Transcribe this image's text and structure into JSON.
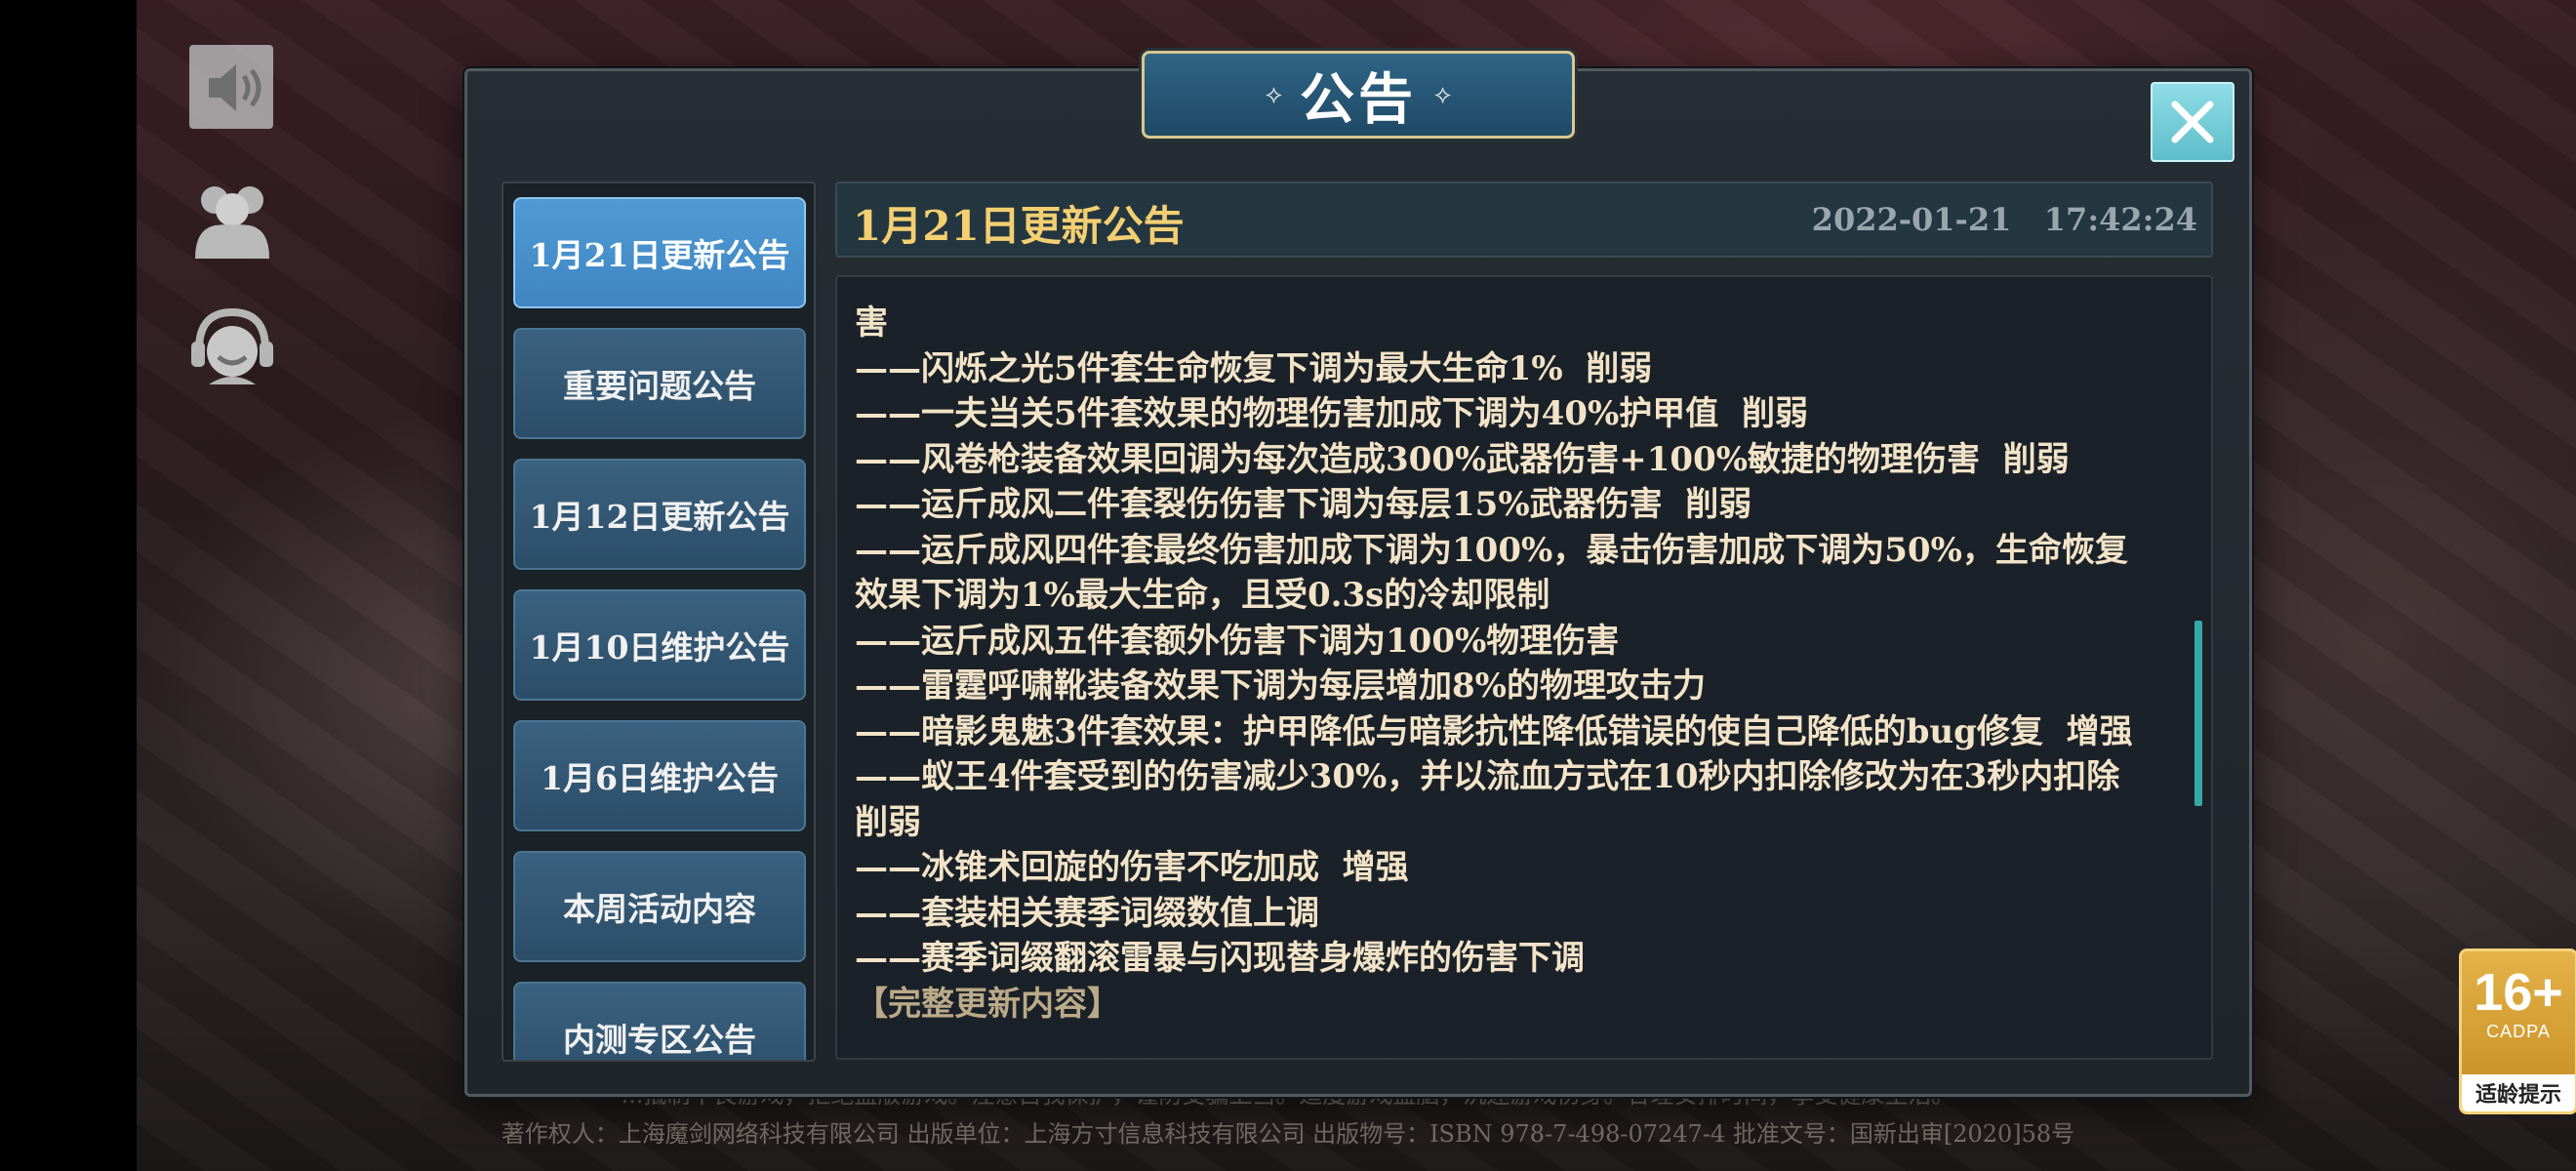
{
  "dialog": {
    "title": "公告",
    "title_ornament_left": "⟡",
    "title_ornament_right": "⟡"
  },
  "sidebar": {
    "tabs": [
      {
        "label": "1月21日更新公告",
        "active": true
      },
      {
        "label": "重要问题公告",
        "active": false
      },
      {
        "label": "1月12日更新公告",
        "active": false
      },
      {
        "label": "1月10日维护公告",
        "active": false
      },
      {
        "label": "1月6日维护公告",
        "active": false
      },
      {
        "label": "本周活动内容",
        "active": false
      },
      {
        "label": "内测专区公告",
        "active": false
      }
    ]
  },
  "notice": {
    "title": "1月21日更新公告",
    "date": "2022-01-21   17:42:24",
    "lines": [
      "害",
      "——闪烁之光5件套生命恢复下调为最大生命1%  削弱",
      "——一夫当关5件套效果的物理伤害加成下调为40%护甲值  削弱",
      "——风卷枪装备效果回调为每次造成300%武器伤害+100%敏捷的物理伤害  削弱",
      "——运斤成风二件套裂伤伤害下调为每层15%武器伤害  削弱",
      "——运斤成风四件套最终伤害加成下调为100%，暴击伤害加成下调为50%，生命恢复",
      "效果下调为1%最大生命，且受0.3s的冷却限制",
      "——运斤成风五件套额外伤害下调为100%物理伤害",
      "——雷霆呼啸靴装备效果下调为每层增加8%的物理攻击力",
      "——暗影鬼魅3件套效果：护甲降低与暗影抗性降低错误的使自己降低的bug修复  增强",
      "——蚁王4件套受到的伤害减少30%，并以流血方式在10秒内扣除修改为在3秒内扣除",
      "削弱",
      "——冰锥术回旋的伤害不吃加成  增强",
      "——套装相关赛季词缀数值上调",
      "——赛季词缀翻滚雷暴与闪现替身爆炸的伤害下调",
      "",
      "【完整更新内容】"
    ]
  },
  "copyright": {
    "line1": "...抵制不良游戏，拒绝盗版游戏。注意自我保护，谨防受骗上当。适度游戏益脑，沉迷游戏伤身。合理安排时间，享受健康生活。",
    "line2": "著作权人：上海魔剑网络科技有限公司   出版单位：上海方寸信息科技有限公司   出版物号：ISBN 978-7-498-07247-4   批准文号：国新出审[2020]58号"
  },
  "age_rating": {
    "number": "16+",
    "org": "CADPA",
    "tip": "适龄提示"
  },
  "hud": {
    "icons": [
      "speaker-icon",
      "friends-icon",
      "customer-service-icon"
    ]
  }
}
